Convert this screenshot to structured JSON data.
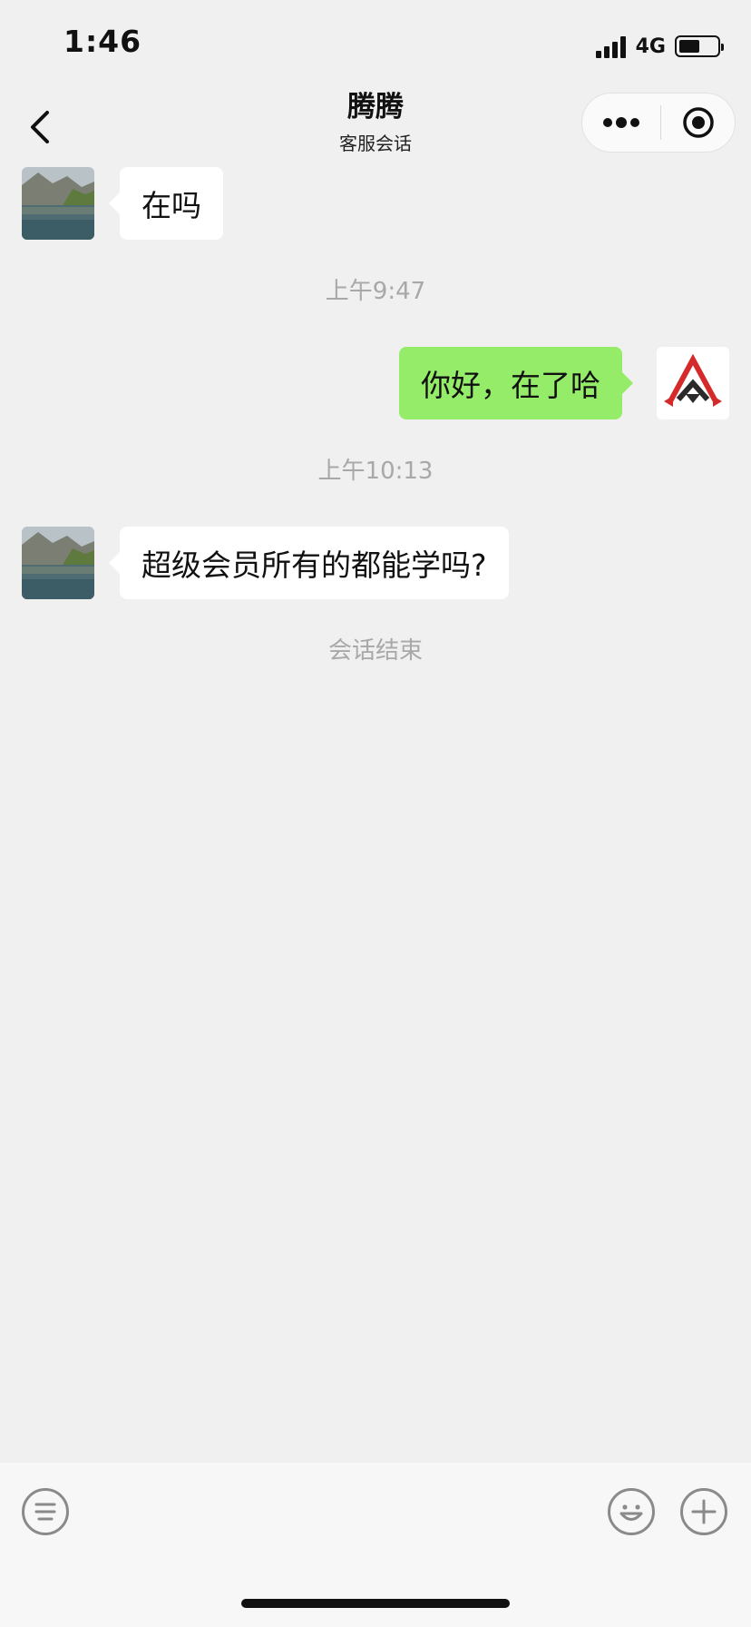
{
  "status_bar": {
    "time": "1:46",
    "network": "4G",
    "battery_level": 0.55
  },
  "header": {
    "title": "腾腾",
    "subtitle": "客服会话"
  },
  "messages": [
    {
      "side": "left",
      "text": "在吗"
    },
    {
      "timestamp": "上午9:47"
    },
    {
      "side": "right",
      "text": "你好，在了哈"
    },
    {
      "timestamp": "上午10:13"
    },
    {
      "side": "left",
      "text": "超级会员所有的都能学吗?"
    },
    {
      "system": "会话结束"
    }
  ],
  "icons": {
    "back": "chevron-left-icon",
    "more": "more-dots-icon",
    "close": "target-close-icon",
    "text_menu": "text-lines-icon",
    "emoji": "smiley-icon",
    "add": "plus-icon"
  },
  "colors": {
    "background": "#f0f0f0",
    "sent_bubble": "#95ec69",
    "received_bubble": "#ffffff",
    "timestamp_text": "#a8a8a8"
  }
}
